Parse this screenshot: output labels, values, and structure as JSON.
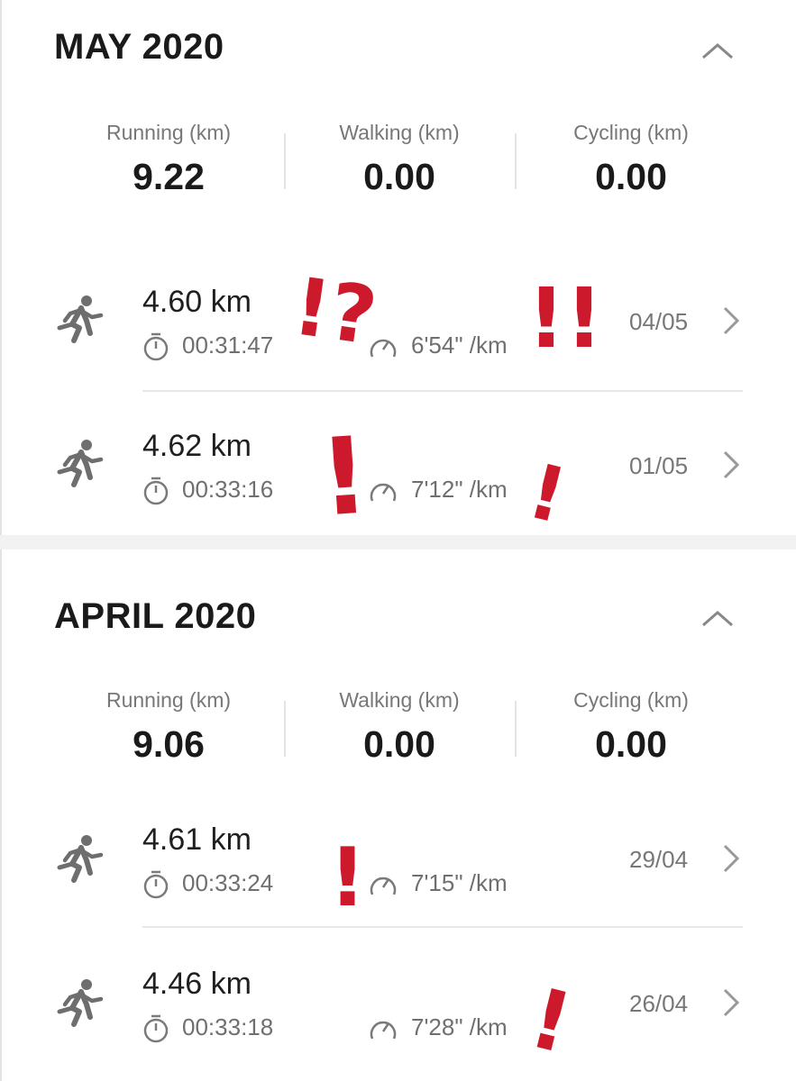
{
  "months": [
    {
      "title": "MAY 2020",
      "stats": [
        {
          "label": "Running (km)",
          "value": "9.22"
        },
        {
          "label": "Walking (km)",
          "value": "0.00"
        },
        {
          "label": "Cycling (km)",
          "value": "0.00"
        }
      ],
      "activities": [
        {
          "distance": "4.60 km",
          "duration": "00:31:47",
          "pace": "6'54\" /km",
          "date": "04/05"
        },
        {
          "distance": "4.62 km",
          "duration": "00:33:16",
          "pace": "7'12\" /km",
          "date": "01/05"
        }
      ]
    },
    {
      "title": "APRIL 2020",
      "stats": [
        {
          "label": "Running (km)",
          "value": "9.06"
        },
        {
          "label": "Walking (km)",
          "value": "0.00"
        },
        {
          "label": "Cycling (km)",
          "value": "0.00"
        }
      ],
      "activities": [
        {
          "distance": "4.61 km",
          "duration": "00:33:24",
          "pace": "7'15\" /km",
          "date": "29/04"
        },
        {
          "distance": "4.46 km",
          "duration": "00:33:18",
          "pace": "7'28\" /km",
          "date": "26/04"
        }
      ]
    }
  ],
  "annotations": [
    {
      "text": "!?",
      "color": "#cc1a2c"
    },
    {
      "text": "!!",
      "color": "#cc1a2c"
    },
    {
      "text": "!",
      "color": "#cc1a2c"
    },
    {
      "text": "!",
      "color": "#cc1a2c"
    },
    {
      "text": "!",
      "color": "#cc1a2c"
    },
    {
      "text": "!",
      "color": "#cc1a2c"
    }
  ],
  "icons": {
    "collapse": "chevron-up-icon",
    "activity": "running-person-icon",
    "duration": "stopwatch-icon",
    "pace": "speedometer-icon",
    "detail": "chevron-right-icon"
  }
}
